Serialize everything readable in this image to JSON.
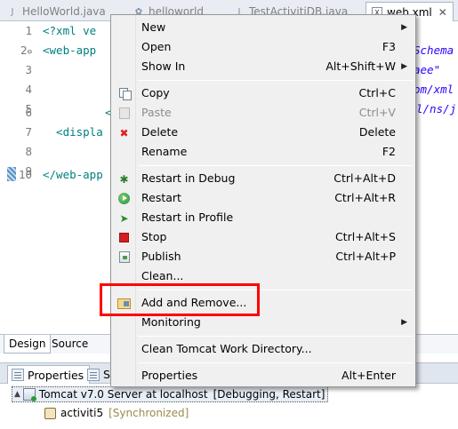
{
  "tabs": [
    {
      "label": "HelloWorld.java",
      "icon": "java-file-icon",
      "active": false
    },
    {
      "label": "helloworld",
      "icon": "config-icon",
      "active": false
    },
    {
      "label": "TestActivitiDB.java",
      "icon": "java-file-icon",
      "active": false
    },
    {
      "label": "web.xml",
      "icon": "xml-file-icon",
      "active": true
    }
  ],
  "tab_close": "✕",
  "editor": {
    "line_numbers": [
      "1",
      "2",
      "3",
      "4",
      "5",
      "6",
      "7",
      "8",
      "9",
      "10"
    ],
    "fold_marker": "⊖",
    "lines": [
      "<?xml ve",
      "<web-app",
      "",
      "",
      "",
      "",
      "  <displa",
      "",
      "",
      "</web-app"
    ],
    "line6_fragment": "<",
    "right_fragments": [
      "Schema",
      "aee\"",
      "om/xml",
      "l/ns/j"
    ]
  },
  "mode_tabs": {
    "design": "Design",
    "source": "Source"
  },
  "menu": {
    "items": [
      {
        "label": "New",
        "shortcut": "",
        "submenu": true,
        "icon": "",
        "disabled": false
      },
      {
        "label": "Open",
        "shortcut": "F3",
        "submenu": false,
        "icon": "",
        "disabled": false
      },
      {
        "label": "Show In",
        "shortcut": "Alt+Shift+W",
        "submenu": true,
        "icon": "",
        "disabled": false
      },
      {
        "label": "Copy",
        "shortcut": "Ctrl+C",
        "submenu": false,
        "icon": "copy-icon",
        "disabled": false
      },
      {
        "label": "Paste",
        "shortcut": "Ctrl+V",
        "submenu": false,
        "icon": "paste-icon",
        "disabled": true
      },
      {
        "label": "Delete",
        "shortcut": "Delete",
        "submenu": false,
        "icon": "delete-icon",
        "disabled": false
      },
      {
        "label": "Rename",
        "shortcut": "F2",
        "submenu": false,
        "icon": "",
        "disabled": false
      },
      {
        "label": "Restart in Debug",
        "shortcut": "Ctrl+Alt+D",
        "submenu": false,
        "icon": "debug-icon",
        "disabled": false
      },
      {
        "label": "Restart",
        "shortcut": "Ctrl+Alt+R",
        "submenu": false,
        "icon": "restart-icon",
        "disabled": false
      },
      {
        "label": "Restart in Profile",
        "shortcut": "",
        "submenu": false,
        "icon": "profile-icon",
        "disabled": false
      },
      {
        "label": "Stop",
        "shortcut": "Ctrl+Alt+S",
        "submenu": false,
        "icon": "stop-icon",
        "disabled": false
      },
      {
        "label": "Publish",
        "shortcut": "Ctrl+Alt+P",
        "submenu": false,
        "icon": "publish-icon",
        "disabled": false
      },
      {
        "label": "Clean...",
        "shortcut": "",
        "submenu": false,
        "icon": "",
        "disabled": false
      },
      {
        "label": "Add and Remove...",
        "shortcut": "",
        "submenu": false,
        "icon": "add-remove-icon",
        "disabled": false
      },
      {
        "label": "Monitoring",
        "shortcut": "",
        "submenu": true,
        "icon": "",
        "disabled": false
      },
      {
        "label": "Clean Tomcat Work Directory...",
        "shortcut": "",
        "submenu": false,
        "icon": "",
        "disabled": false
      },
      {
        "label": "Properties",
        "shortcut": "Alt+Enter",
        "submenu": false,
        "icon": "",
        "disabled": false
      }
    ],
    "submenu_arrow": "▶"
  },
  "panel": {
    "tabs": [
      {
        "label": "Properties",
        "icon": "properties-icon",
        "active": true
      },
      {
        "label": "S",
        "icon": "servers-icon",
        "active": false
      }
    ],
    "server": {
      "expander": "▲",
      "name": "Tomcat v7.0 Server at localhost",
      "state": "[Debugging, Restart]"
    },
    "module": {
      "name": "activiti5",
      "status": "[Synchronized]"
    }
  },
  "colors": {
    "highlight_border": "#ff0000",
    "menu_bg": "#f0f0f0",
    "tag_color": "#008080"
  }
}
